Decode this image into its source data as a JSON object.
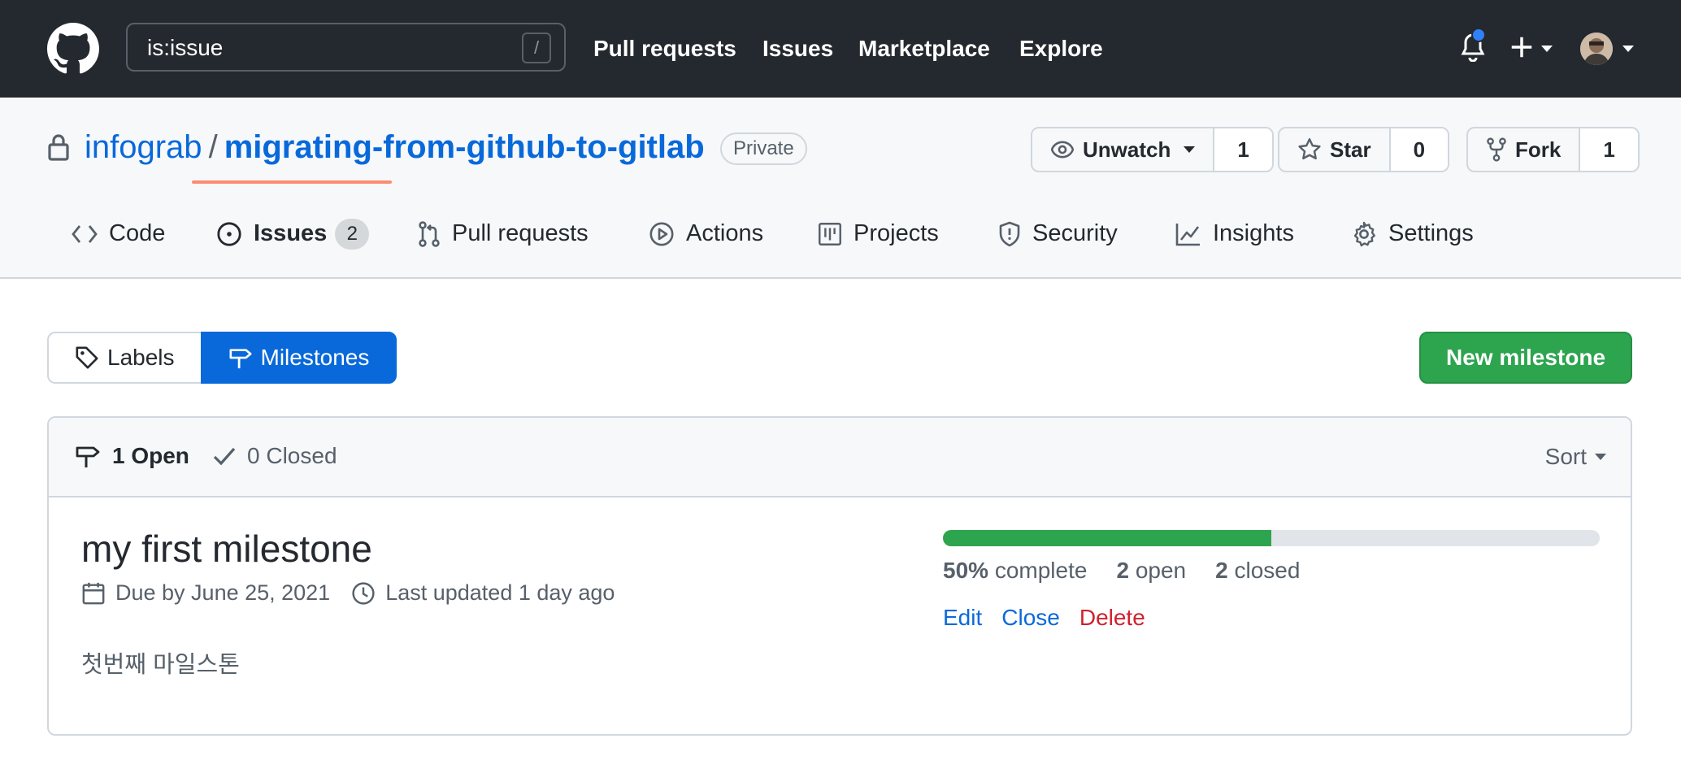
{
  "header": {
    "search_value": "is:issue",
    "search_shortcut": "/",
    "nav": [
      "Pull requests",
      "Issues",
      "Marketplace",
      "Explore"
    ]
  },
  "repo": {
    "owner": "infograb",
    "separator": "/",
    "name": "migrating-from-github-to-gitlab",
    "visibility": "Private",
    "watch_label": "Unwatch",
    "watch_count": "1",
    "star_label": "Star",
    "star_count": "0",
    "fork_label": "Fork",
    "fork_count": "1"
  },
  "tabs": [
    {
      "label": "Code",
      "icon": "code-icon"
    },
    {
      "label": "Issues",
      "icon": "issue-opened-icon",
      "counter": "2",
      "active": true
    },
    {
      "label": "Pull requests",
      "icon": "git-pull-request-icon"
    },
    {
      "label": "Actions",
      "icon": "play-icon"
    },
    {
      "label": "Projects",
      "icon": "project-icon"
    },
    {
      "label": "Security",
      "icon": "shield-icon"
    },
    {
      "label": "Insights",
      "icon": "graph-icon"
    },
    {
      "label": "Settings",
      "icon": "gear-icon"
    }
  ],
  "subnav": {
    "labels": "Labels",
    "milestones": "Milestones",
    "new_milestone": "New milestone"
  },
  "milestones": {
    "open_label": "1 Open",
    "closed_label": "0 Closed",
    "sort_label": "Sort",
    "items": [
      {
        "title": "my first milestone",
        "due": "Due by June 25, 2021",
        "updated": "Last updated 1 day ago",
        "description": "첫번째 마일스톤",
        "progress_percent": 50,
        "percent_label": "50%",
        "complete_word": "complete",
        "open_count": "2",
        "open_word": "open",
        "closed_count": "2",
        "closed_word": "closed",
        "edit": "Edit",
        "close": "Close",
        "delete": "Delete"
      }
    ]
  },
  "colors": {
    "header_bg": "#24292f",
    "link": "#0969da",
    "primary_green": "#2da44e",
    "danger": "#cf222e",
    "tab_underline": "#fd8c73"
  }
}
